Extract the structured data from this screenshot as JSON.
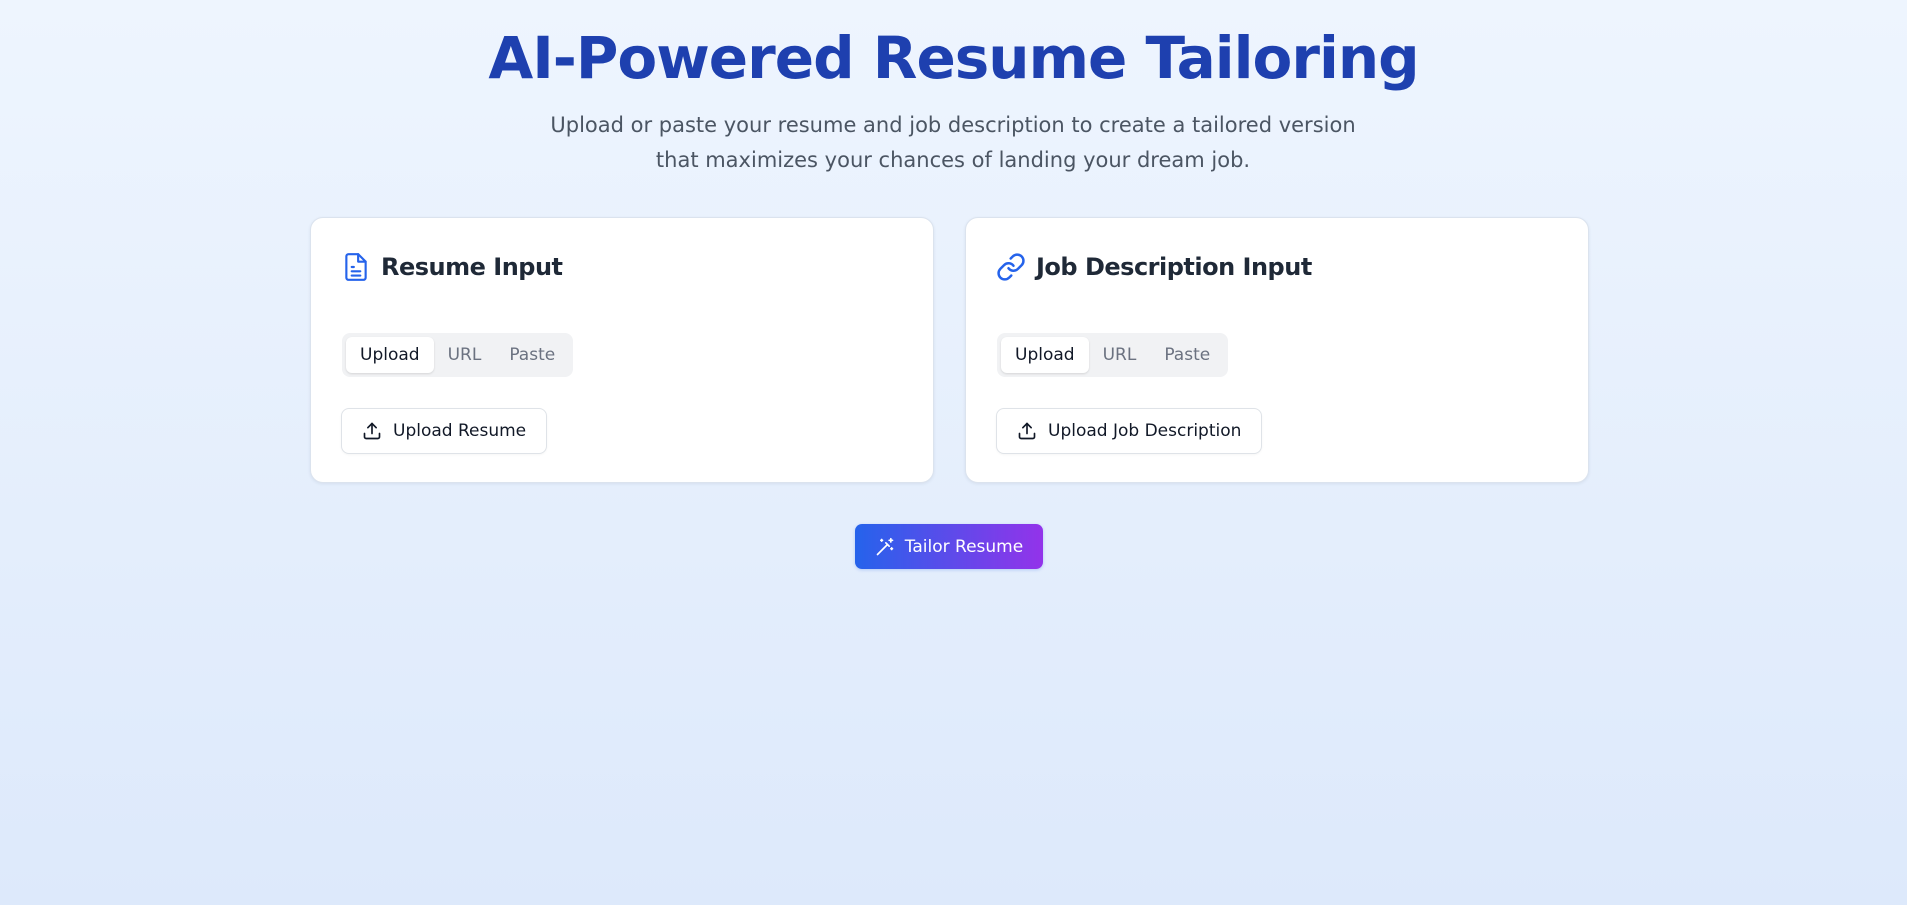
{
  "header": {
    "title": "AI-Powered Resume Tailoring",
    "subtitle_line1": "Upload or paste your resume and job description to create a tailored version",
    "subtitle_line2": "that maximizes your chances of landing your dream job."
  },
  "resume_card": {
    "icon": "document-icon",
    "title": "Resume Input",
    "tabs": [
      {
        "label": "Upload",
        "active": true
      },
      {
        "label": "URL",
        "active": false
      },
      {
        "label": "Paste",
        "active": false
      }
    ],
    "upload_button": {
      "icon": "upload-icon",
      "label": "Upload Resume"
    }
  },
  "job_card": {
    "icon": "link-icon",
    "title": "Job Description Input",
    "tabs": [
      {
        "label": "Upload",
        "active": true
      },
      {
        "label": "URL",
        "active": false
      },
      {
        "label": "Paste",
        "active": false
      }
    ],
    "upload_button": {
      "icon": "upload-icon",
      "label": "Upload Job Description"
    }
  },
  "tailor_button": {
    "icon": "magic-wand-icon",
    "label": "Tailor Resume"
  },
  "colors": {
    "title": "#1e40af",
    "card_icon": "#2563eb",
    "gradient_start": "#2563eb",
    "gradient_end": "#9333ea"
  }
}
